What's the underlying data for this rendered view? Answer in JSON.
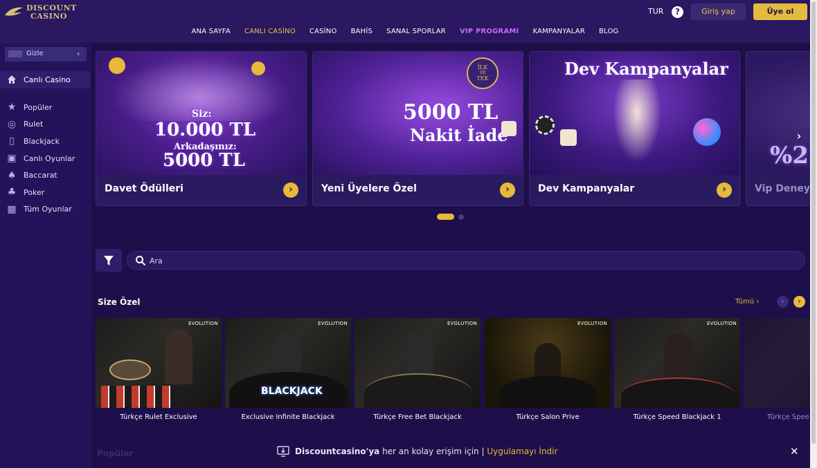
{
  "brand": {
    "line1": "DISCOUNT",
    "line2": "CASINO"
  },
  "header": {
    "lang": "TUR",
    "help": "?",
    "login": "Giriş yap",
    "register": "Üye ol"
  },
  "nav": [
    "ANA SAYFA",
    "CANLI CASİNO",
    "CASİNO",
    "BAHİS",
    "SANAL SPORLAR",
    "VIP PROGRAMI",
    "KAMPANYALAR",
    "BLOG"
  ],
  "sidebar": {
    "hide_label": "Gizle",
    "home_label": "Canlı Casino",
    "items": [
      "Popüler",
      "Rulet",
      "Blackjack",
      "Canlı Oyunlar",
      "Baccarat",
      "Poker",
      "Tüm Oyunlar"
    ]
  },
  "banners": [
    {
      "title": "Davet Ödülleri",
      "art": [
        "Siz:",
        "10.000 TL",
        "Arkadaşınız:",
        "5000 TL"
      ]
    },
    {
      "title": "Yeni Üyelere Özel",
      "art": [
        "5000 TL",
        "Nakit İade",
        "İLK",
        "VE",
        "TEK"
      ]
    },
    {
      "title": "Dev Kampanyalar",
      "art": [
        "Dev Kampanyalar"
      ]
    },
    {
      "title": "Vip Deneyi",
      "art": [
        "%2"
      ]
    }
  ],
  "carousel": {
    "active_index": 0,
    "count": 2
  },
  "search": {
    "placeholder": "Ara"
  },
  "section": {
    "title": "Size Özel",
    "see_all": "Tümü"
  },
  "games": [
    {
      "name": "Türkçe Rulet Exclusive",
      "provider": "EVOLUTION"
    },
    {
      "name": "Exclusive Infinite Blackjack",
      "provider": "EVOLUTION",
      "overlay": "BLACKJACK"
    },
    {
      "name": "Türkçe Free Bet Blackjack",
      "provider": "EVOLUTION"
    },
    {
      "name": "Türkçe Salon Prive",
      "provider": "EVOLUTION"
    },
    {
      "name": "Türkçe Speed Blackjack 1",
      "provider": "EVOLUTION"
    },
    {
      "name": "Türkçe Spee",
      "provider": ""
    }
  ],
  "bottom_bar": {
    "faded_section": "Popüler",
    "brand": "Discountcasino'ya",
    "text": " her an kolay erişim için | ",
    "link": "Uygulamayı İndir"
  },
  "colors": {
    "accent": "#e6b93a",
    "vip": "#c26bff",
    "background": "#1e0f4a"
  }
}
